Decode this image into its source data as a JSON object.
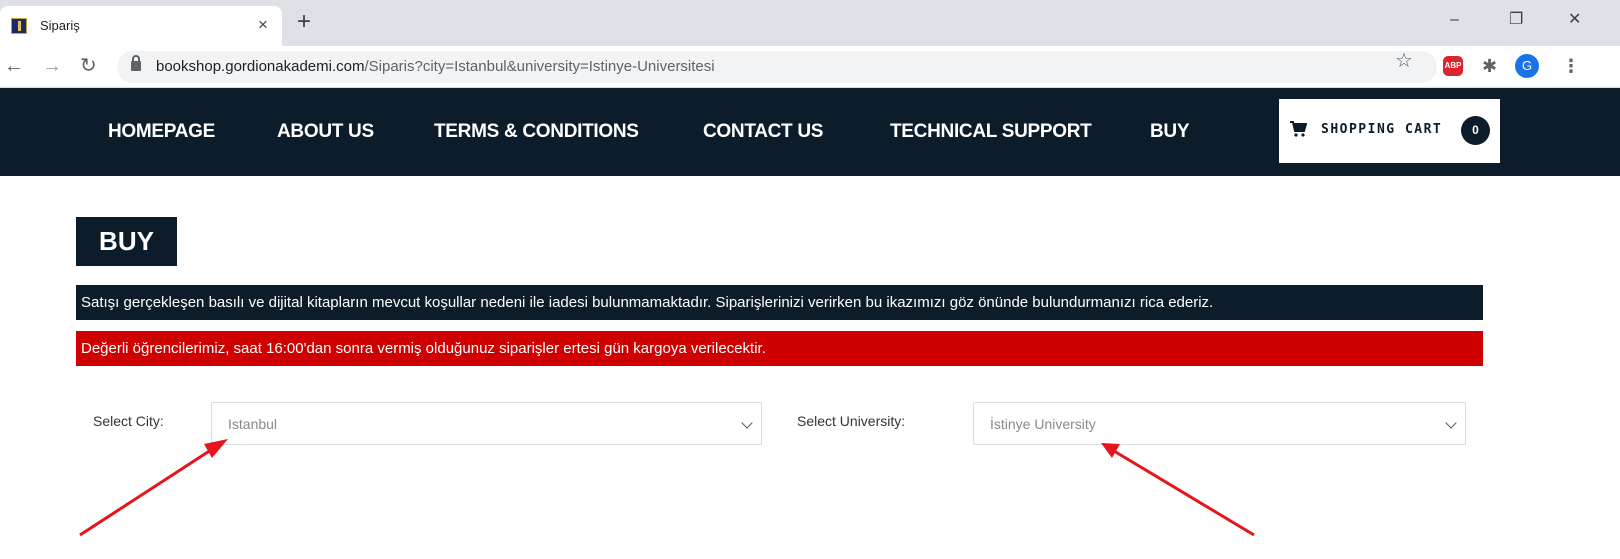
{
  "browser": {
    "tab_title": "Sipariş",
    "tab_close": "×",
    "new_tab": "+",
    "url_host": "bookshop.gordionakademi.com",
    "url_path": "/Siparis?city=Istanbul&university=Istinye-Universitesi",
    "profile_initial": "G",
    "adblock_label": "ABP",
    "window_controls": {
      "minimize": "–",
      "restore": "❐",
      "close": "✕"
    }
  },
  "site_nav": {
    "items": [
      {
        "label": "HOMEPAGE"
      },
      {
        "label": "ABOUT US"
      },
      {
        "label": "TERMS & CONDITIONS"
      },
      {
        "label": "CONTACT US"
      },
      {
        "label": "TECHNICAL SUPPORT"
      },
      {
        "label": "BUY"
      }
    ],
    "cart": {
      "label": "SHOPPING CART",
      "count": "0"
    }
  },
  "page": {
    "title": "BUY",
    "notice_return": "Satışı gerçekleşen basılı ve dijital kitapların mevcut koşullar nedeni ile iadesi bulunmamaktadır. Siparişlerinizi verirken bu ikazımızı göz önünde bulundurmanızı rica ederiz.",
    "notice_shipping": "Değerli öğrencilerimiz, saat 16:00'dan sonra vermiş olduğunuz siparişler ertesi gün kargoya verilecektir.",
    "city": {
      "label": "Select City:",
      "value": "Istanbul"
    },
    "university": {
      "label": "Select University:",
      "value": "İstinye University"
    }
  },
  "colors": {
    "navy": "#0d1c2a",
    "alert_red": "#cf0000",
    "annotation_arrow": "#e8141c"
  }
}
